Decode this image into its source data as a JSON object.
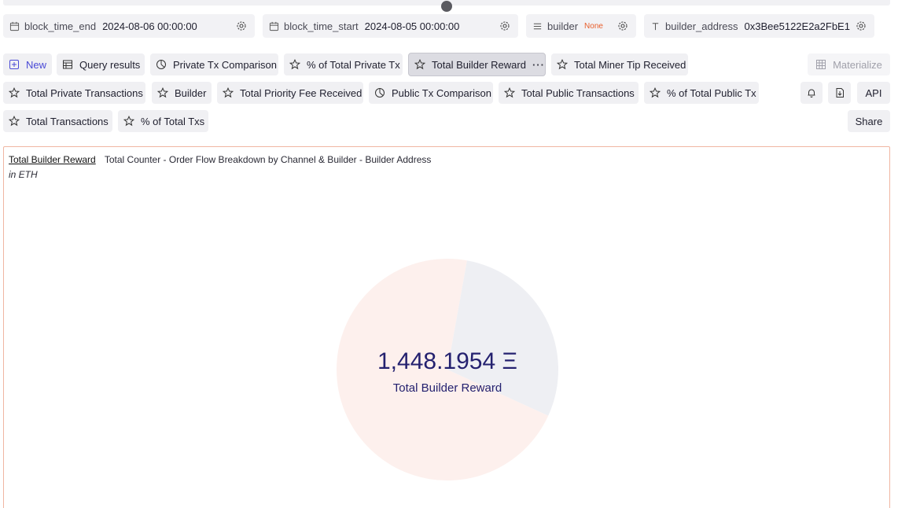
{
  "parameters": [
    {
      "name": "block_time_end",
      "value": "2024-08-06 00:00:00",
      "icon": "calendar-icon"
    },
    {
      "name": "block_time_start",
      "value": "2024-08-05 00:00:00",
      "icon": "calendar-icon"
    },
    {
      "name": "builder",
      "value": "None",
      "icon": "list-icon"
    },
    {
      "name": "builder_address",
      "value": "0x3Bee5122E2a2FbE1",
      "icon": "text-icon"
    }
  ],
  "tabs_row1": [
    {
      "label": "New",
      "icon": "plus-square-icon"
    },
    {
      "label": "Query results",
      "icon": "table-icon"
    },
    {
      "label": "Private Tx Comparison",
      "icon": "pie-chart-icon"
    },
    {
      "label": "% of Total Private Tx",
      "icon": "star-icon"
    },
    {
      "label": "Total Builder Reward",
      "icon": "star-icon",
      "active": true
    },
    {
      "label": "Total Miner Tip Received",
      "icon": "star-icon"
    }
  ],
  "tabs_row2": [
    {
      "label": "Total Private Transactions",
      "icon": "star-icon"
    },
    {
      "label": "Builder",
      "icon": "star-icon"
    },
    {
      "label": "Total Priority Fee Received",
      "icon": "star-icon"
    },
    {
      "label": "Public Tx Comparison",
      "icon": "pie-chart-icon"
    },
    {
      "label": "Total Public Transactions",
      "icon": "star-icon"
    },
    {
      "label": "% of Total Public Tx",
      "icon": "star-icon"
    }
  ],
  "tabs_row3": [
    {
      "label": "Total Transactions",
      "icon": "star-icon"
    },
    {
      "label": "% of Total Txs",
      "icon": "star-icon"
    }
  ],
  "actions": {
    "materialize": "Materialize",
    "api": "API",
    "share": "Share",
    "more": "···"
  },
  "panel": {
    "title": "Total Builder Reward",
    "subtitle": "Total Counter - Order Flow Breakdown by Channel & Builder - Builder Address",
    "caption": "in ETH",
    "counter_value": "1,448.1954 Ξ",
    "counter_label": "Total Builder Reward"
  },
  "chart_data": {
    "type": "pie",
    "slices": [
      {
        "share": 0.71,
        "color": "#fdf0ed"
      },
      {
        "share": 0.29,
        "color": "#eeeff3"
      }
    ]
  }
}
